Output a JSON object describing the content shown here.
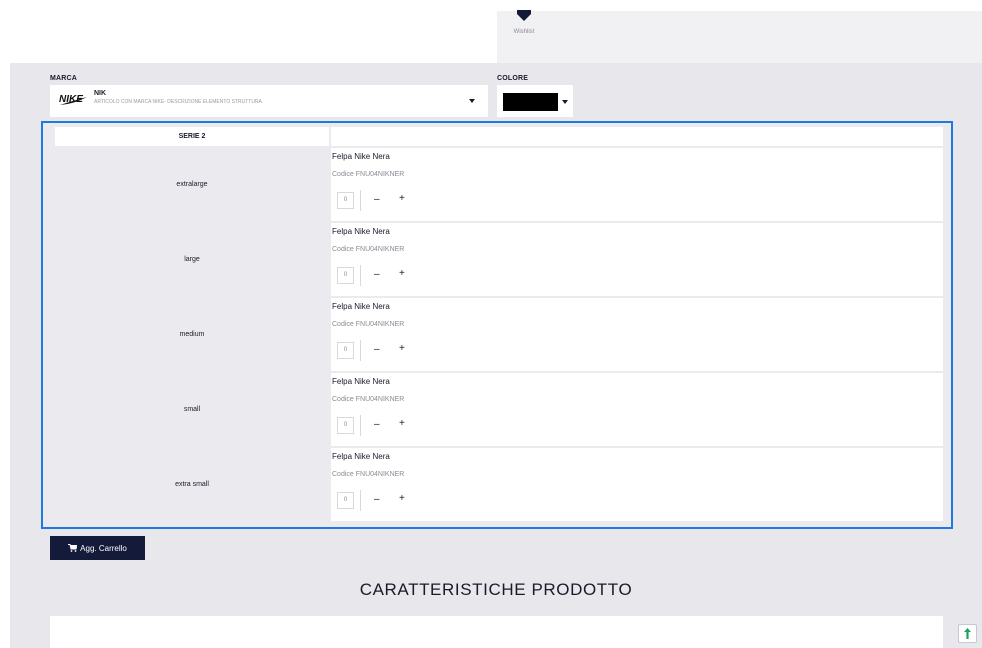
{
  "wishlist": {
    "label": "Wishlist"
  },
  "brand": {
    "label": "MARCA",
    "code": "NIK",
    "description": "ARTICOLO CON MARCA NIKE- DESCRIZIONE ELEMENTO STRUTTURA"
  },
  "color": {
    "label": "COLORE",
    "swatch": "#000000"
  },
  "grid": {
    "series_label": "SERIE 2",
    "rows": [
      {
        "size": "extralarge",
        "product": "Felpa Nike Nera",
        "code": "Codice FNU04NIKNER",
        "qty": "0"
      },
      {
        "size": "large",
        "product": "Felpa Nike Nera",
        "code": "Codice FNU04NIKNER",
        "qty": "0"
      },
      {
        "size": "medium",
        "product": "Felpa Nike Nera",
        "code": "Codice FNU04NIKNER",
        "qty": "0"
      },
      {
        "size": "small",
        "product": "Felpa Nike Nera",
        "code": "Codice FNU04NIKNER",
        "qty": "0"
      },
      {
        "size": "extra small",
        "product": "Felpa Nike Nera",
        "code": "Codice FNU04NIKNER",
        "qty": "0"
      }
    ],
    "minus": "–",
    "plus": "+"
  },
  "cart_button": {
    "label": "Agg. Carrello"
  },
  "features": {
    "title": "CARATTERISTICHE PRODOTTO"
  },
  "colors": {
    "accent_border": "#1f7ae0",
    "button_bg": "#141a3a",
    "page_bg": "#e7e7ec"
  }
}
